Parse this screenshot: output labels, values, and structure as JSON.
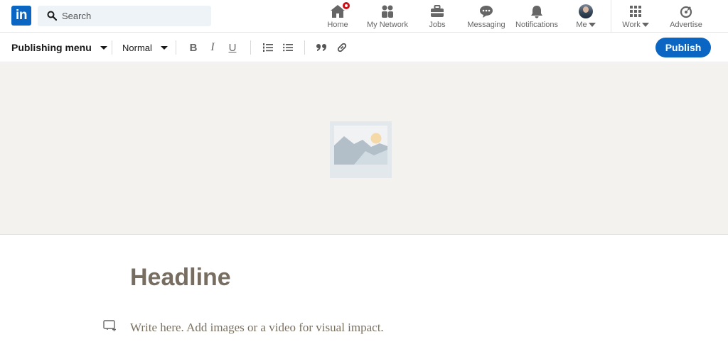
{
  "nav": {
    "logo": "in",
    "search_placeholder": "Search",
    "items": [
      {
        "label": "Home",
        "icon": "home-icon"
      },
      {
        "label": "My Network",
        "icon": "people-icon"
      },
      {
        "label": "Jobs",
        "icon": "briefcase-icon"
      },
      {
        "label": "Messaging",
        "icon": "chat-icon"
      },
      {
        "label": "Notifications",
        "icon": "bell-icon"
      },
      {
        "label": "Me",
        "icon": "avatar"
      },
      {
        "label": "Work",
        "icon": "grid-icon"
      },
      {
        "label": "Advertise",
        "icon": "compass-icon"
      }
    ]
  },
  "toolbar": {
    "publishing_menu": "Publishing menu",
    "style_select": "Normal",
    "bold": "B",
    "italic": "I",
    "underline": "U",
    "publish_label": "Publish"
  },
  "editor": {
    "headline_placeholder": "Headline",
    "body_placeholder": "Write here. Add images or a video for visual impact."
  },
  "colors": {
    "brand": "#0a66c2",
    "cover_bg": "#f3f2ef",
    "placeholder_text": "#776d60",
    "notification_badge": "#cc1016"
  }
}
